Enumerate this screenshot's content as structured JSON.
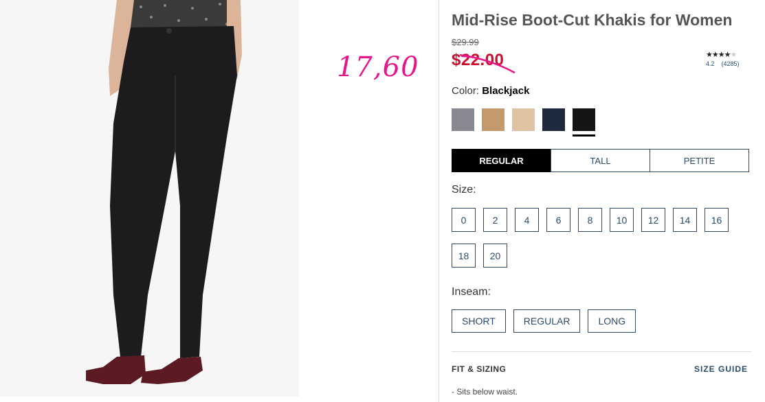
{
  "annotation": {
    "handwritten_price": "17,60",
    "color": "#e6168a"
  },
  "product": {
    "title": "Mid-Rise Boot-Cut Khakis for Women",
    "original_price": "$29.99",
    "sale_price": "$22.00",
    "rating": {
      "stars": 4.2,
      "value": "4.2",
      "count": "(4285)"
    },
    "color_label": "Color:",
    "color_value": "Blackjack",
    "swatches": [
      {
        "name": "grey",
        "hex": "#8a8890"
      },
      {
        "name": "khaki",
        "hex": "#c49a6c"
      },
      {
        "name": "stone",
        "hex": "#e0c3a2"
      },
      {
        "name": "navy",
        "hex": "#1e2a3f"
      },
      {
        "name": "blackjack",
        "hex": "#151515",
        "selected": true
      }
    ],
    "fit_tabs": [
      "REGULAR",
      "TALL",
      "PETITE"
    ],
    "size_label": "Size:",
    "sizes": [
      "0",
      "2",
      "4",
      "6",
      "8",
      "10",
      "12",
      "14",
      "16",
      "18",
      "20"
    ],
    "inseam_label": "Inseam:",
    "inseams": [
      "SHORT",
      "REGULAR",
      "LONG"
    ],
    "fit_sizing_label": "FIT & SIZING",
    "size_guide_label": "SIZE GUIDE",
    "fit_note": "-  Sits below waist."
  },
  "colors": {
    "accent": "#2a4a6b",
    "sale": "#c8102e"
  }
}
